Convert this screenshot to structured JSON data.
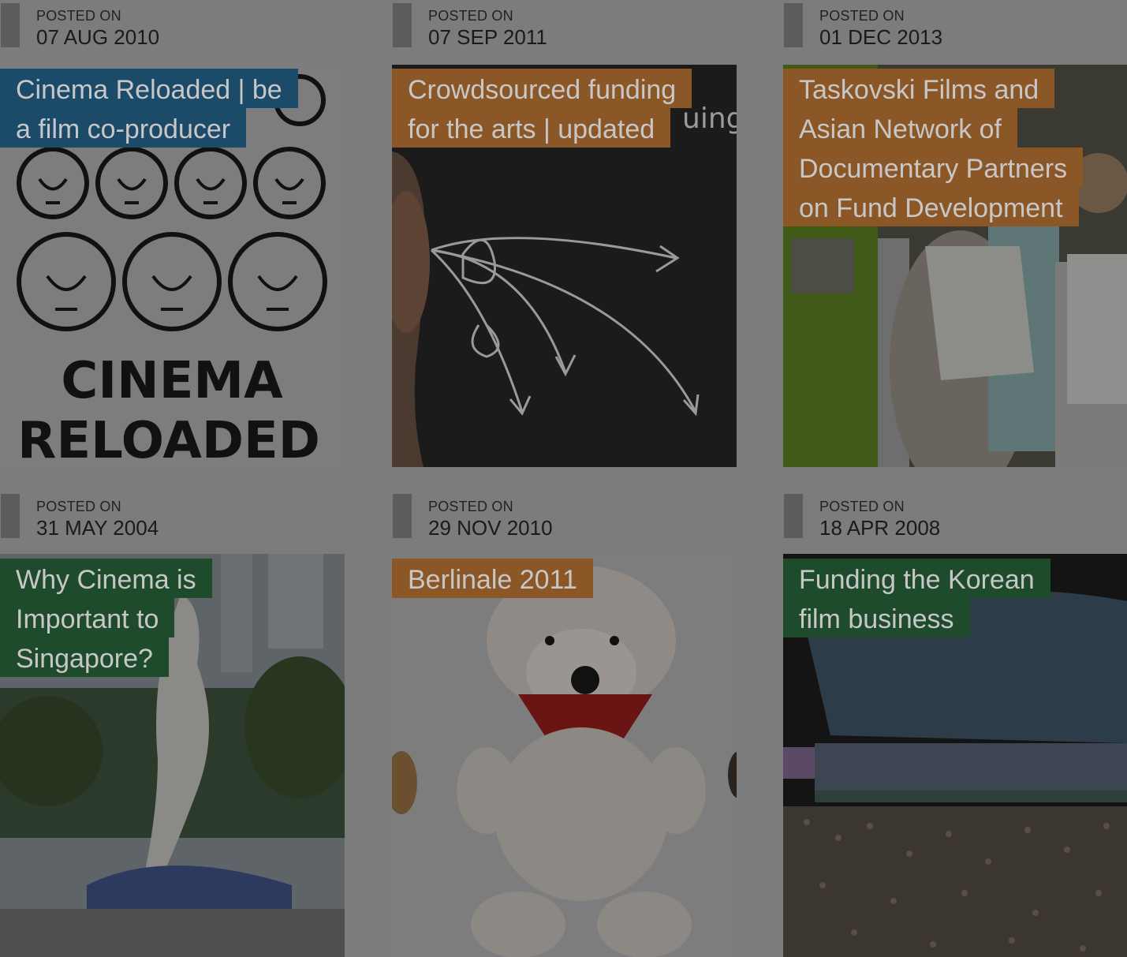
{
  "posts": [
    {
      "label": "POSTED ON",
      "date": "07 AUG 2010",
      "title_lines": [
        "Cinema Reloaded | be",
        "a film co-producer"
      ],
      "category_color": "#1c4a69",
      "image_text": [
        "CINEMA",
        "RELOADED"
      ]
    },
    {
      "label": "POSTED ON",
      "date": "07 SEP 2011",
      "title_lines": [
        "Crowdsourced funding",
        "for the arts | updated"
      ],
      "category_color": "#8b5727",
      "image_text": [
        "uing"
      ]
    },
    {
      "label": "POSTED ON",
      "date": "01 DEC 2013",
      "title_lines": [
        "Taskovski Films and",
        "Asian Network of",
        "Documentary Partners",
        "on Fund Development"
      ],
      "category_color": "#8b5727"
    },
    {
      "label": "POSTED ON",
      "date": "31 MAY 2004",
      "title_lines": [
        "Why Cinema is",
        "Important to",
        "Singapore?"
      ],
      "category_color": "#1f4b2d"
    },
    {
      "label": "POSTED ON",
      "date": "29 NOV 2010",
      "title_lines": [
        "Berlinale 2011"
      ],
      "category_color": "#8b5727"
    },
    {
      "label": "POSTED ON",
      "date": "18 APR 2008",
      "title_lines": [
        "Funding the Korean",
        "film business"
      ],
      "category_color": "#1f4b2d"
    }
  ]
}
